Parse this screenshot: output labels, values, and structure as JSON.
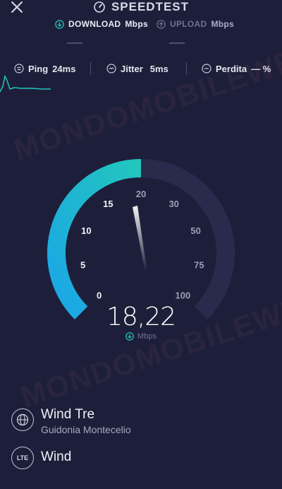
{
  "header": {
    "title": "SPEEDTEST",
    "tabs": [
      {
        "label": "DOWNLOAD",
        "unit": "Mbps"
      },
      {
        "label": "UPLOAD",
        "unit": "Mbps"
      }
    ]
  },
  "stats": {
    "ping": {
      "label": "Ping",
      "value": "24ms"
    },
    "jitter": {
      "label": "Jitter",
      "value": "5ms"
    },
    "loss": {
      "label": "Perdita",
      "value": "— %"
    }
  },
  "gauge": {
    "ticks": [
      "0",
      "5",
      "10",
      "15",
      "20",
      "30",
      "50",
      "75",
      "100"
    ],
    "progress": 0.5
  },
  "result": {
    "value": "18,22",
    "unit": "Mbps"
  },
  "provider": {
    "name": "Wind Tre",
    "location": "Guidonia Montecelio"
  },
  "network": {
    "badge": "LTE",
    "name": "Wind"
  },
  "watermark": "MONDOMOBILEWEB",
  "colors": {
    "background": "#1d1f3a",
    "accent_start": "#1aa6e6",
    "accent_end": "#23c6bd",
    "track": "#282b4b"
  }
}
